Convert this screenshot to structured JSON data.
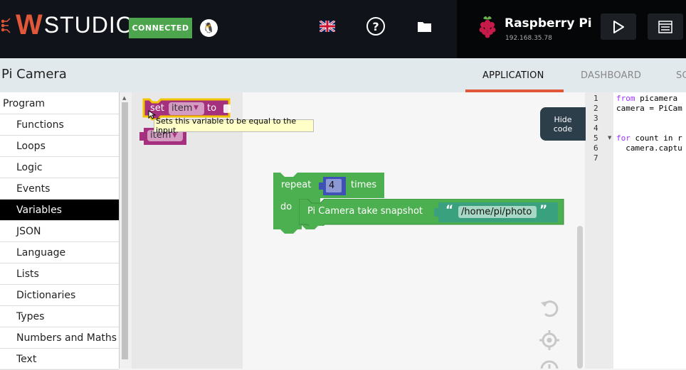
{
  "header": {
    "logo_mark": "W",
    "logo_text": "STUDIO",
    "connection_status": "CONNECTED",
    "device_name": "Raspberry Pi",
    "device_ip": "192.168.35.78"
  },
  "project": {
    "title": "Pi Camera",
    "tabs": [
      {
        "label": "APPLICATION",
        "active": true
      },
      {
        "label": "DASHBOARD",
        "active": false
      },
      {
        "label": "SC",
        "active": false
      }
    ]
  },
  "sidebar": {
    "items": [
      {
        "label": "Program",
        "selected": false,
        "indent": false
      },
      {
        "label": "Functions",
        "selected": false,
        "indent": true
      },
      {
        "label": "Loops",
        "selected": false,
        "indent": true
      },
      {
        "label": "Logic",
        "selected": false,
        "indent": true
      },
      {
        "label": "Events",
        "selected": false,
        "indent": true
      },
      {
        "label": "Variables",
        "selected": true,
        "indent": true
      },
      {
        "label": "JSON",
        "selected": false,
        "indent": true
      },
      {
        "label": "Language",
        "selected": false,
        "indent": true
      },
      {
        "label": "Lists",
        "selected": false,
        "indent": true
      },
      {
        "label": "Dictionaries",
        "selected": false,
        "indent": true
      },
      {
        "label": "Types",
        "selected": false,
        "indent": true
      },
      {
        "label": "Numbers and Maths",
        "selected": false,
        "indent": true
      },
      {
        "label": "Text",
        "selected": false,
        "indent": true
      }
    ]
  },
  "flyout": {
    "set_block": {
      "keyword": "set",
      "variable": "item",
      "suffix": "to"
    },
    "get_block": {
      "variable": "item"
    },
    "tooltip": "Sets this variable to be equal to the input."
  },
  "workspace": {
    "repeat_block": {
      "keyword": "repeat",
      "count": "4",
      "suffix": "times",
      "do_label": "do"
    },
    "snapshot_block": {
      "label": "Pi Camera take snapshot",
      "open_quote": "“",
      "path": "/home/pi/photo",
      "close_quote": "”"
    },
    "hide_code": {
      "line1": "Hide",
      "line2": "code"
    }
  },
  "code_editor": {
    "lines": [
      {
        "num": "1",
        "kw": "from",
        "text": " picamera"
      },
      {
        "num": "2",
        "kw": "",
        "text": "camera = PiCam"
      },
      {
        "num": "3",
        "kw": "",
        "text": ""
      },
      {
        "num": "4",
        "kw": "",
        "text": ""
      },
      {
        "num": "5",
        "kw": "for",
        "text": " count in r"
      },
      {
        "num": "6",
        "kw": "",
        "text": "  camera.captu"
      },
      {
        "num": "7",
        "kw": "",
        "text": ""
      }
    ]
  },
  "colors": {
    "accent": "#e0573a",
    "connected": "#4da64d",
    "loop_block": "#4caf50",
    "variable_block": "#a5307e",
    "number_block": "#3f51b5",
    "text_block": "#3aa17e"
  }
}
